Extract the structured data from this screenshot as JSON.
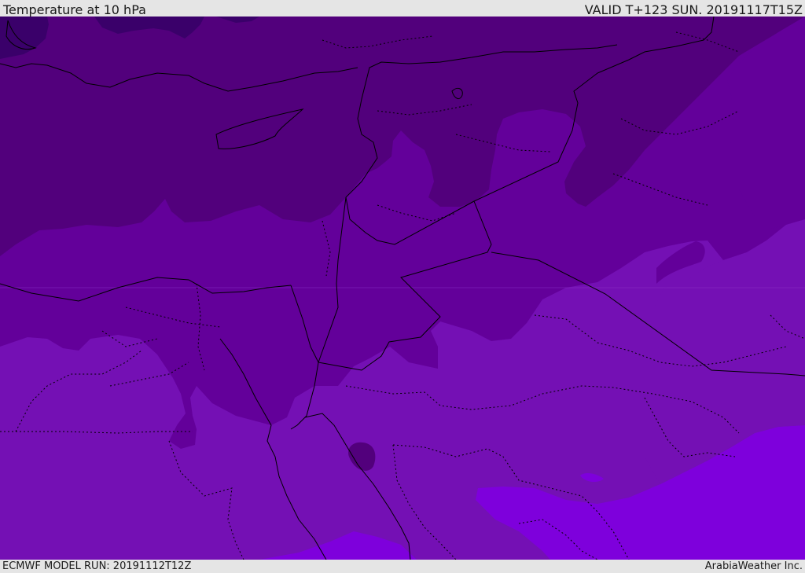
{
  "header": {
    "title": "Temperature at 10 hPa",
    "valid_time": "VALID T+123 SUN. 20191117T15Z"
  },
  "footer": {
    "model_run": "ECMWF MODEL RUN: 20191112T12Z",
    "credit": "ArabiaWeather Inc."
  },
  "colors": {
    "band_darkest": "#3a006a",
    "band_dark": "#52007c",
    "band_mid": "#63009a",
    "band_light": "#7410b4",
    "band_bright": "#7e00dc",
    "border_line": "#000000",
    "frame": "#e5e5e5"
  }
}
